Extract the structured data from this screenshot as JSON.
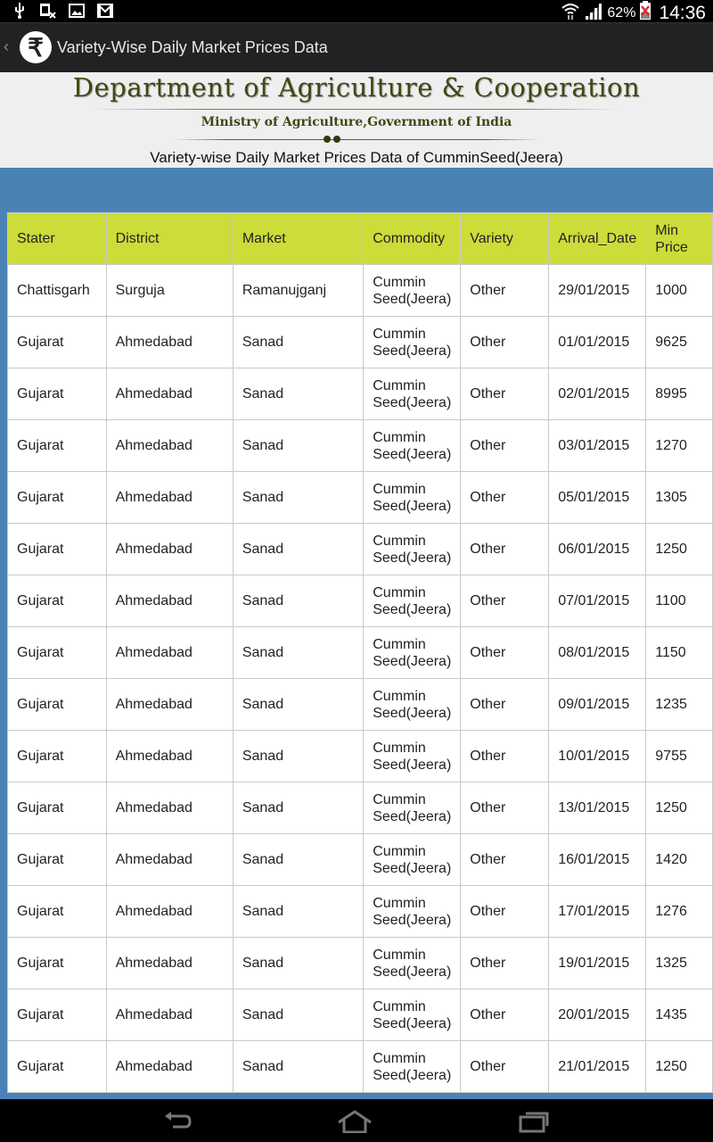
{
  "status_bar": {
    "left_icons": [
      "usb-icon",
      "sim-error-icon",
      "image-icon",
      "gmail-icon"
    ],
    "right_icons": [
      "wifi-icon",
      "signal-icon",
      "battery-icon"
    ],
    "battery_percent": "62%",
    "time": "14:36"
  },
  "action_bar": {
    "back_glyph": "‹",
    "logo_glyph": "₹",
    "title": "Variety-Wise Daily Market Prices Data"
  },
  "banner": {
    "department": "Department of Agriculture & Cooperation",
    "ministry": "Ministry of Agriculture,Government of India",
    "subtitle": "Variety-wise Daily Market Prices Data of CumminSeed(Jeera)"
  },
  "table": {
    "headers": [
      "Stater",
      "District",
      "Market",
      "Commodity",
      "Variety",
      "Arrival_Date",
      "Min Price"
    ],
    "rows": [
      [
        "Chattisgarh",
        "Surguja",
        "Ramanujganj",
        "Cummin Seed(Jeera)",
        "Other",
        "29/01/2015",
        "1000"
      ],
      [
        "Gujarat",
        "Ahmedabad",
        "Sanad",
        "Cummin Seed(Jeera)",
        "Other",
        "01/01/2015",
        "9625"
      ],
      [
        "Gujarat",
        "Ahmedabad",
        "Sanad",
        "Cummin Seed(Jeera)",
        "Other",
        "02/01/2015",
        "8995"
      ],
      [
        "Gujarat",
        "Ahmedabad",
        "Sanad",
        "Cummin Seed(Jeera)",
        "Other",
        "03/01/2015",
        "1270"
      ],
      [
        "Gujarat",
        "Ahmedabad",
        "Sanad",
        "Cummin Seed(Jeera)",
        "Other",
        "05/01/2015",
        "1305"
      ],
      [
        "Gujarat",
        "Ahmedabad",
        "Sanad",
        "Cummin Seed(Jeera)",
        "Other",
        "06/01/2015",
        "1250"
      ],
      [
        "Gujarat",
        "Ahmedabad",
        "Sanad",
        "Cummin Seed(Jeera)",
        "Other",
        "07/01/2015",
        "1100"
      ],
      [
        "Gujarat",
        "Ahmedabad",
        "Sanad",
        "Cummin Seed(Jeera)",
        "Other",
        "08/01/2015",
        "1150"
      ],
      [
        "Gujarat",
        "Ahmedabad",
        "Sanad",
        "Cummin Seed(Jeera)",
        "Other",
        "09/01/2015",
        "1235"
      ],
      [
        "Gujarat",
        "Ahmedabad",
        "Sanad",
        "Cummin Seed(Jeera)",
        "Other",
        "10/01/2015",
        "9755"
      ],
      [
        "Gujarat",
        "Ahmedabad",
        "Sanad",
        "Cummin Seed(Jeera)",
        "Other",
        "13/01/2015",
        "1250"
      ],
      [
        "Gujarat",
        "Ahmedabad",
        "Sanad",
        "Cummin Seed(Jeera)",
        "Other",
        "16/01/2015",
        "1420"
      ],
      [
        "Gujarat",
        "Ahmedabad",
        "Sanad",
        "Cummin Seed(Jeera)",
        "Other",
        "17/01/2015",
        "1276"
      ],
      [
        "Gujarat",
        "Ahmedabad",
        "Sanad",
        "Cummin Seed(Jeera)",
        "Other",
        "19/01/2015",
        "1325"
      ],
      [
        "Gujarat",
        "Ahmedabad",
        "Sanad",
        "Cummin Seed(Jeera)",
        "Other",
        "20/01/2015",
        "1435"
      ],
      [
        "Gujarat",
        "Ahmedabad",
        "Sanad",
        "Cummin Seed(Jeera)",
        "Other",
        "21/01/2015",
        "1250"
      ]
    ]
  },
  "nav_bar": {
    "buttons": [
      "back-icon",
      "home-icon",
      "recent-apps-icon"
    ]
  },
  "colors": {
    "header_bg": "#cddc39",
    "page_bg": "#4a82b5",
    "banner_text": "#3b4a12"
  }
}
